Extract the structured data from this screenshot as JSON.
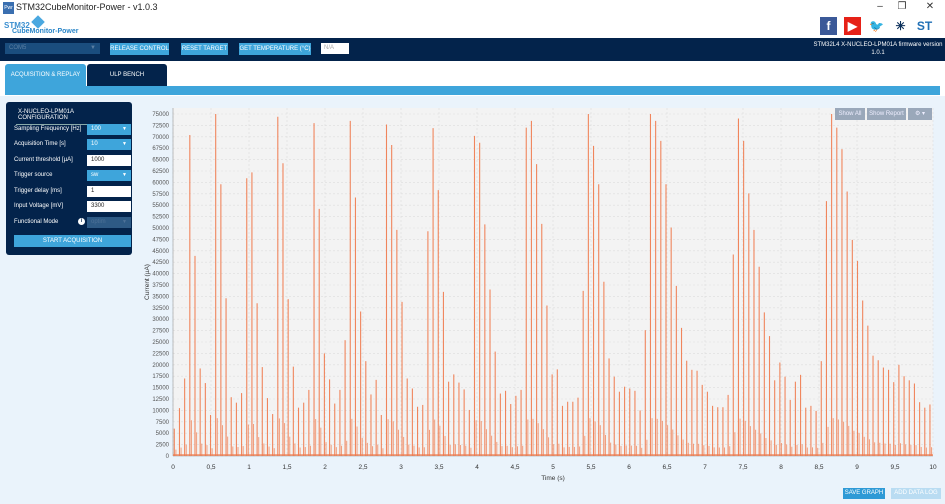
{
  "window": {
    "title": "STM32CubeMonitor-Power - v1.0.3",
    "icon_text": "Pwr",
    "minimize": "–",
    "maximize": "❐",
    "close": "✕"
  },
  "logo": {
    "line1": "STM32",
    "line2": "CubeMonitor-Power"
  },
  "social": [
    {
      "name": "facebook-icon",
      "glyph": "f",
      "color": "#3b5998"
    },
    {
      "name": "youtube-icon",
      "glyph": "▶",
      "color": "#e62117"
    },
    {
      "name": "twitter-icon",
      "glyph": "🐦",
      "color": "#1da1f2"
    },
    {
      "name": "network-icon",
      "glyph": "✳",
      "color": "#0b2f5a"
    },
    {
      "name": "st-logo-icon",
      "glyph": "ST",
      "color": "#1f6fb5"
    }
  ],
  "toolbar": {
    "com_port": "COM5",
    "release": "RELEASE CONTROL",
    "reset": "RESET TARGET",
    "temperature": "GET TEMPERATURE (°C)",
    "temperature_value": "N/A",
    "fw_line1": "STM32L4 X-NUCLEO-LPM01A firmware version",
    "fw_line2": "1.0.1"
  },
  "tabs": [
    {
      "label": "ACQUISITION & REPLAY"
    },
    {
      "label": "ULP BENCH"
    }
  ],
  "config": {
    "title": "X-NUCLEO-LPM01A CONFIGURATION",
    "sampling_label": "Sampling Frequency [Hz]",
    "sampling_value": "100",
    "acq_label": "Acquisition Time [s]",
    "acq_value": "10",
    "threshold_label": "Current threshold [µA]",
    "threshold_value": "1000",
    "trigger_label": "Trigger source",
    "trigger_value": "sw",
    "delay_label": "Trigger delay [ms]",
    "delay_value": "1",
    "voltage_label": "Input Voltage [mV]",
    "voltage_value": "3300",
    "mode_label": "Functional Mode",
    "mode_value": "optim",
    "start": "START ACQUISITION"
  },
  "chart_controls": {
    "show_all": "Show All",
    "show_report": "Show Report",
    "settings": "⚙ ▾"
  },
  "buttons": {
    "save_graph": "SAVE GRAPH",
    "add_data_log": "ADD DATA LOG"
  },
  "colors": {
    "navy": "#03234b",
    "accent": "#3ea5db",
    "series": "#f07a4c"
  },
  "chart_data": {
    "type": "line",
    "title": "",
    "xlabel": "Time (s)",
    "ylabel": "Current (µA)",
    "xlim": [
      0,
      10
    ],
    "ylim": [
      0,
      75000
    ],
    "grid": true,
    "x_ticks": [
      "0",
      "0,5",
      "1",
      "1,5",
      "2",
      "2,5",
      "3",
      "3,5",
      "4",
      "4,5",
      "5",
      "5,5",
      "6",
      "6,5",
      "7",
      "7,5",
      "8",
      "8,5",
      "9",
      "9,5",
      "10"
    ],
    "y_ticks": [
      "0",
      "2500",
      "5000",
      "7500",
      "10000",
      "12500",
      "15000",
      "17500",
      "20000",
      "22500",
      "25000",
      "27500",
      "30000",
      "32500",
      "35000",
      "37500",
      "40000",
      "42500",
      "45000",
      "47500",
      "50000",
      "52500",
      "55000",
      "57500",
      "60000",
      "62500",
      "65000",
      "67500",
      "70000",
      "72500",
      "75000"
    ],
    "spike_t_start": 0.017,
    "spike_t_end": 9.96,
    "spike_peaks": [
      6000,
      10500,
      17000,
      70400,
      43900,
      19200,
      16000,
      9000,
      75000,
      59600,
      34600,
      12900,
      11700,
      13800,
      60900,
      62200,
      33500,
      19500,
      12700,
      9200,
      74400,
      64200,
      34400,
      19600,
      10600,
      11700,
      14500,
      73000,
      54200,
      22500,
      16800,
      11500,
      14500,
      25400,
      73500,
      56700,
      31700,
      20800,
      13500,
      16700,
      9000,
      72700,
      68200,
      49600,
      33800,
      17000,
      14800,
      10800,
      11200,
      49300,
      71900,
      58300,
      36000,
      16300,
      17900,
      16100,
      14600,
      10100,
      70200,
      68700,
      50800,
      36500,
      22900,
      13700,
      14300,
      11400,
      13200,
      14500,
      72000,
      73500,
      64000,
      50900,
      33000,
      17900,
      19000,
      11000,
      11900,
      11900,
      12800,
      36200,
      75000,
      68000,
      59600,
      38200,
      21400,
      17400,
      14100,
      15200,
      14800,
      14300,
      10000,
      27600,
      75000,
      73500,
      69100,
      59600,
      50100,
      37300,
      28100,
      20900,
      18900,
      18700,
      15600,
      14100,
      11000,
      10700,
      10700,
      13400,
      44200,
      74000,
      69100,
      57600,
      49600,
      41500,
      31500,
      26300,
      16600,
      20500,
      17400,
      12300,
      16300,
      17800,
      10600,
      11000,
      9900,
      20800,
      55900,
      75000,
      72000,
      67300,
      58000,
      47400,
      42800,
      34100,
      28600,
      22000,
      21000,
      19400,
      18900,
      16200,
      20000,
      17500,
      16600,
      15900,
      11800,
      10600,
      11300
    ]
  }
}
